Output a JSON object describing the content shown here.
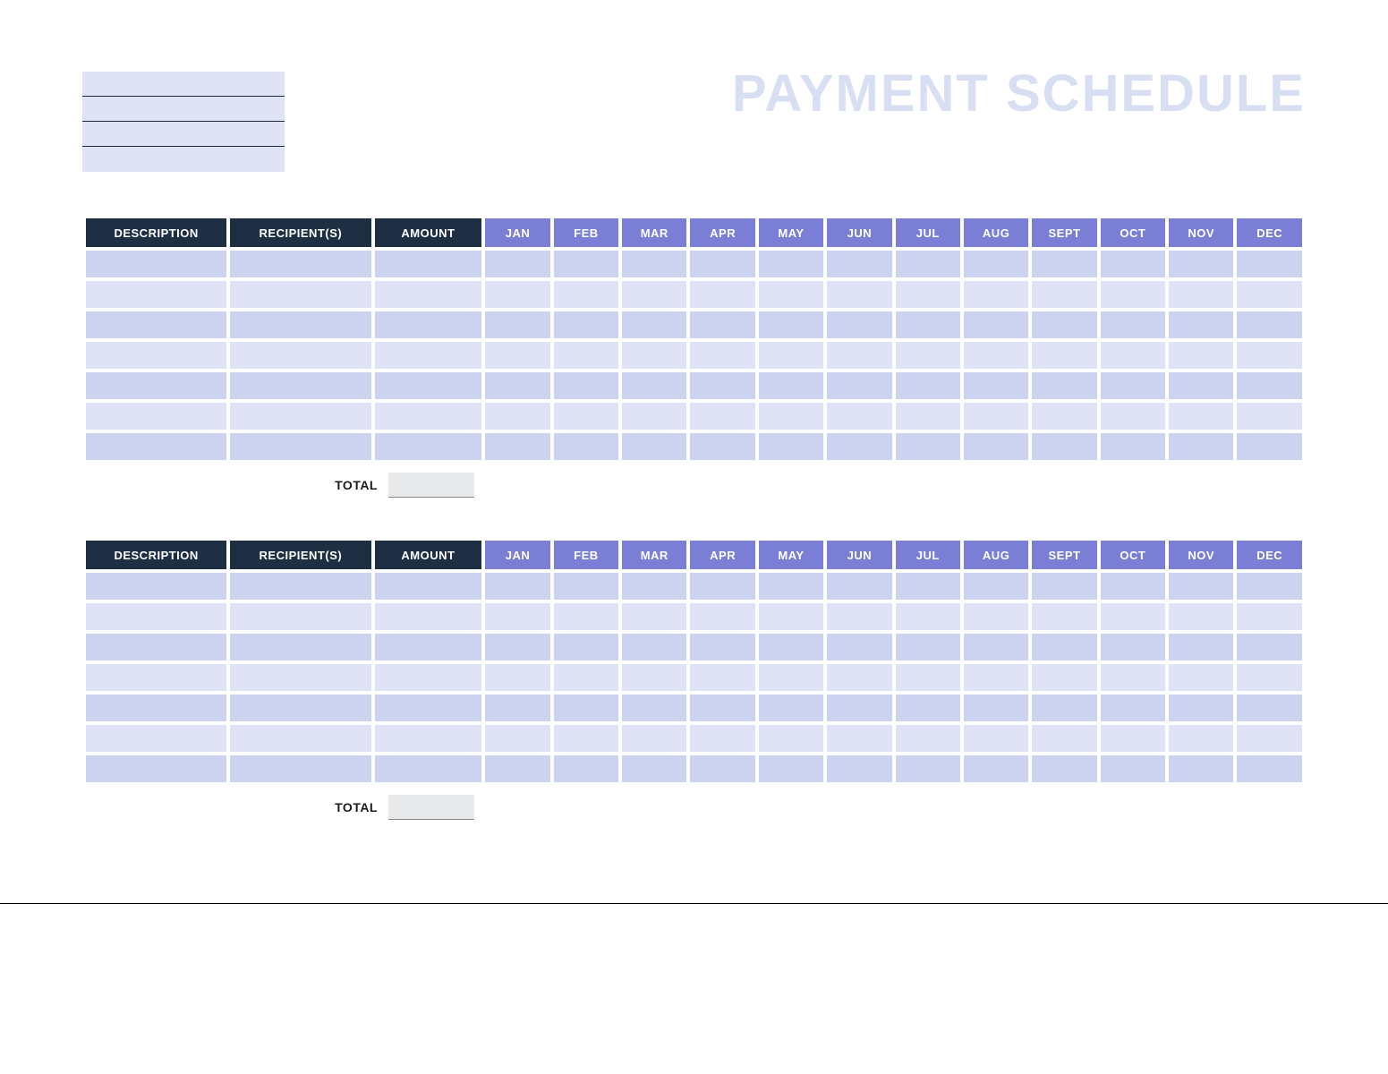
{
  "title": "PAYMENT SCHEDULE",
  "header_lines": [
    "",
    "",
    "",
    ""
  ],
  "table_headers": {
    "dark": [
      "DESCRIPTION",
      "RECIPIENT(S)",
      "AMOUNT"
    ],
    "months": [
      "JAN",
      "FEB",
      "MAR",
      "APR",
      "MAY",
      "JUN",
      "JUL",
      "AUG",
      "SEPT",
      "OCT",
      "NOV",
      "DEC"
    ]
  },
  "tables": [
    {
      "rows": [
        {
          "description": "",
          "recipients": "",
          "amount": "",
          "months": [
            "",
            "",
            "",
            "",
            "",
            "",
            "",
            "",
            "",
            "",
            "",
            ""
          ]
        },
        {
          "description": "",
          "recipients": "",
          "amount": "",
          "months": [
            "",
            "",
            "",
            "",
            "",
            "",
            "",
            "",
            "",
            "",
            "",
            ""
          ]
        },
        {
          "description": "",
          "recipients": "",
          "amount": "",
          "months": [
            "",
            "",
            "",
            "",
            "",
            "",
            "",
            "",
            "",
            "",
            "",
            ""
          ]
        },
        {
          "description": "",
          "recipients": "",
          "amount": "",
          "months": [
            "",
            "",
            "",
            "",
            "",
            "",
            "",
            "",
            "",
            "",
            "",
            ""
          ]
        },
        {
          "description": "",
          "recipients": "",
          "amount": "",
          "months": [
            "",
            "",
            "",
            "",
            "",
            "",
            "",
            "",
            "",
            "",
            "",
            ""
          ]
        },
        {
          "description": "",
          "recipients": "",
          "amount": "",
          "months": [
            "",
            "",
            "",
            "",
            "",
            "",
            "",
            "",
            "",
            "",
            "",
            ""
          ]
        },
        {
          "description": "",
          "recipients": "",
          "amount": "",
          "months": [
            "",
            "",
            "",
            "",
            "",
            "",
            "",
            "",
            "",
            "",
            "",
            ""
          ]
        }
      ],
      "total_label": "TOTAL",
      "total_value": ""
    },
    {
      "rows": [
        {
          "description": "",
          "recipients": "",
          "amount": "",
          "months": [
            "",
            "",
            "",
            "",
            "",
            "",
            "",
            "",
            "",
            "",
            "",
            ""
          ]
        },
        {
          "description": "",
          "recipients": "",
          "amount": "",
          "months": [
            "",
            "",
            "",
            "",
            "",
            "",
            "",
            "",
            "",
            "",
            "",
            ""
          ]
        },
        {
          "description": "",
          "recipients": "",
          "amount": "",
          "months": [
            "",
            "",
            "",
            "",
            "",
            "",
            "",
            "",
            "",
            "",
            "",
            ""
          ]
        },
        {
          "description": "",
          "recipients": "",
          "amount": "",
          "months": [
            "",
            "",
            "",
            "",
            "",
            "",
            "",
            "",
            "",
            "",
            "",
            ""
          ]
        },
        {
          "description": "",
          "recipients": "",
          "amount": "",
          "months": [
            "",
            "",
            "",
            "",
            "",
            "",
            "",
            "",
            "",
            "",
            "",
            ""
          ]
        },
        {
          "description": "",
          "recipients": "",
          "amount": "",
          "months": [
            "",
            "",
            "",
            "",
            "",
            "",
            "",
            "",
            "",
            "",
            "",
            ""
          ]
        },
        {
          "description": "",
          "recipients": "",
          "amount": "",
          "months": [
            "",
            "",
            "",
            "",
            "",
            "",
            "",
            "",
            "",
            "",
            "",
            ""
          ]
        }
      ],
      "total_label": "TOTAL",
      "total_value": ""
    }
  ]
}
